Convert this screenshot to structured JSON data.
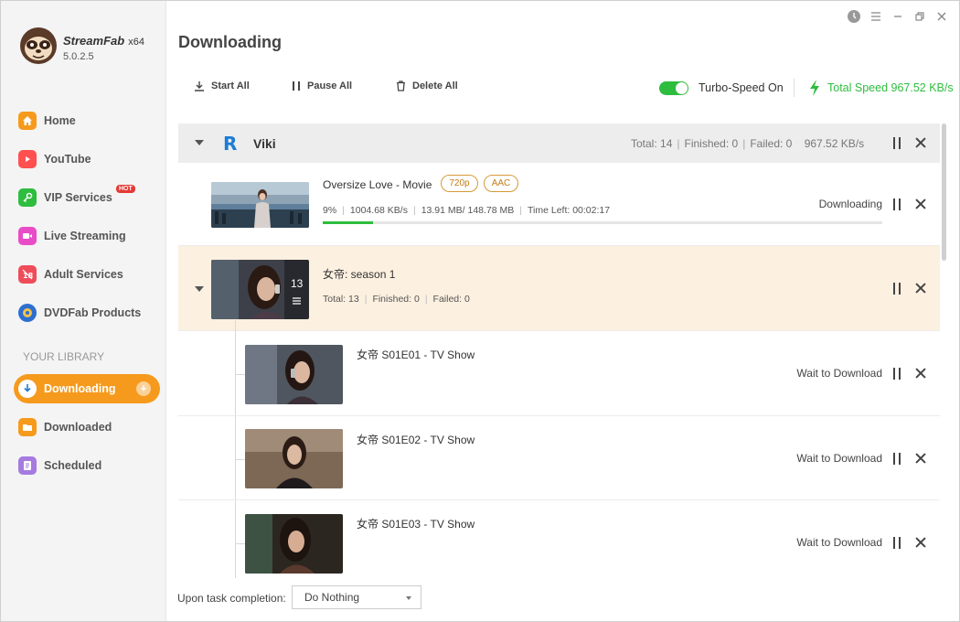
{
  "app": {
    "name": "StreamFab",
    "arch": "x64",
    "version": "5.0.2.5"
  },
  "sidebar": {
    "items": [
      {
        "label": "Home",
        "icon": "home-icon",
        "color": "#f69a1d"
      },
      {
        "label": "YouTube",
        "icon": "youtube-icon",
        "color": "#ff4f4f"
      },
      {
        "label": "VIP Services",
        "icon": "key-icon",
        "color": "#2ebd3e",
        "badge": "HOT"
      },
      {
        "label": "Live Streaming",
        "icon": "video-camera-icon",
        "color": "#e94cc7"
      },
      {
        "label": "Adult Services",
        "icon": "adult-icon",
        "color": "#ef4c5a"
      },
      {
        "label": "DVDFab Products",
        "icon": "dvdfab-icon",
        "color": "#2d6fd0"
      }
    ],
    "library_heading": "YOUR LIBRARY",
    "library": [
      {
        "label": "Downloading",
        "icon": "download-icon",
        "active": true
      },
      {
        "label": "Downloaded",
        "icon": "folder-icon",
        "color": "#f69a1d"
      },
      {
        "label": "Scheduled",
        "icon": "schedule-icon",
        "color": "#a57be0"
      }
    ]
  },
  "page": {
    "title": "Downloading"
  },
  "toolbar": {
    "start_all": "Start All",
    "pause_all": "Pause All",
    "delete_all": "Delete All",
    "turbo_label": "Turbo-Speed On",
    "turbo_on": true,
    "total_speed": "Total Speed 967.52 KB/s"
  },
  "group": {
    "site": "Viki",
    "total": "Total: 14",
    "finished": "Finished: 0",
    "failed": "Failed: 0",
    "speed": "967.52 KB/s"
  },
  "movie": {
    "title": "Oversize Love - Movie",
    "tags": [
      "720p",
      "AAC"
    ],
    "percent_text": "9%",
    "progress": 0.09,
    "speed": "1004.68 KB/s",
    "size": "13.91 MB/ 148.78 MB",
    "time_left": "Time Left: 00:02:17",
    "status": "Downloading"
  },
  "season": {
    "title": "女帝: season 1",
    "episode_count": "13",
    "total": "Total: 13",
    "finished": "Finished: 0",
    "failed": "Failed: 0"
  },
  "episodes": [
    {
      "title": "女帝 S01E01 - TV Show",
      "status": "Wait to Download"
    },
    {
      "title": "女帝 S01E02 - TV Show",
      "status": "Wait to Download"
    },
    {
      "title": "女帝 S01E03 - TV Show",
      "status": "Wait to Download"
    }
  ],
  "footer": {
    "label": "Upon task completion:",
    "select_value": "Do Nothing"
  }
}
